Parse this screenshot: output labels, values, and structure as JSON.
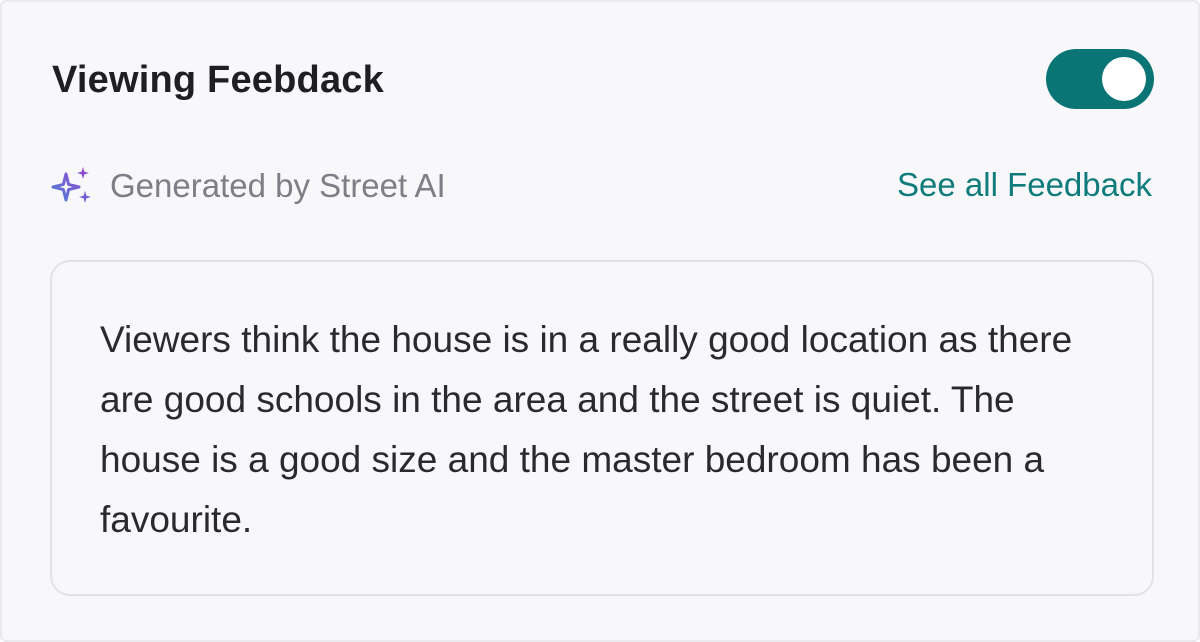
{
  "header": {
    "title": "Viewing Feebdack",
    "toggle_on": true
  },
  "subheader": {
    "icon": "sparkle-icon",
    "generated_label": "Generated by Street AI",
    "see_all_link": "See all Feedback"
  },
  "summary": {
    "text": "Viewers think the house is in a really good location as there are good schools in the area and the street is quiet. The house is a good size and the master bedroom has been a favourite."
  },
  "colors": {
    "accent": "#0b7575",
    "link": "#0f7b7b",
    "sparkle_gradient": [
      "#4f7fd6",
      "#8a4fd0"
    ]
  }
}
